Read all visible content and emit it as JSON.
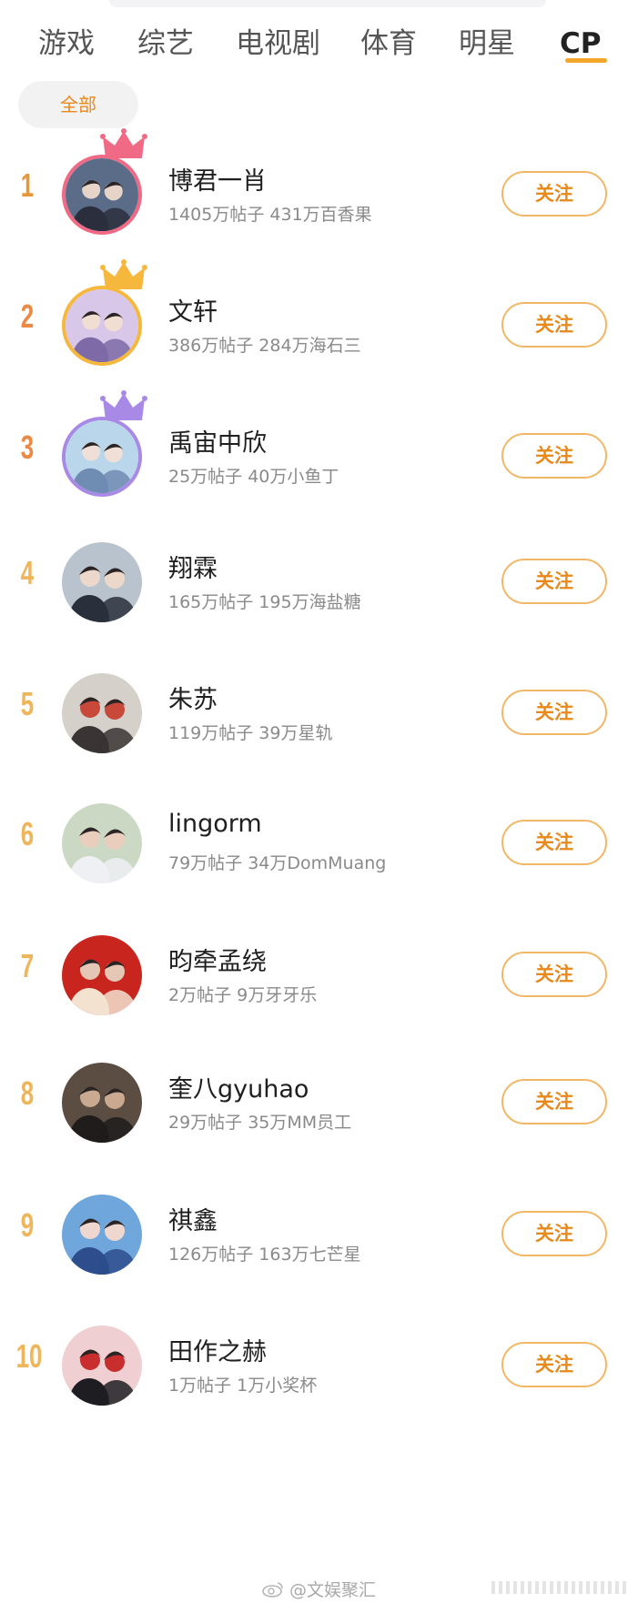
{
  "tabs": [
    {
      "label": "游戏",
      "active": false
    },
    {
      "label": "综艺",
      "active": false
    },
    {
      "label": "电视剧",
      "active": false
    },
    {
      "label": "体育",
      "active": false
    },
    {
      "label": "明星",
      "active": false
    },
    {
      "label": "CP",
      "active": true
    }
  ],
  "filter": {
    "label": "全部"
  },
  "follow_label": "关注",
  "colors": {
    "accent": "#e8891b",
    "rank_gold": "#e5973a",
    "rank_orange": "#ea8a44",
    "rank_light": "#eeb55a",
    "crown_red": "#f06a86",
    "crown_gold": "#f5b73c",
    "crown_purple": "#a88ae6"
  },
  "list": [
    {
      "rank": "1",
      "name": "博君一肖",
      "stats": "1405万帖子 431万百香果",
      "crown": "crown-red-icon",
      "avatar": "cp-photo-avatar"
    },
    {
      "rank": "2",
      "name": "文轩",
      "stats": "386万帖子 284万海石三",
      "crown": "crown-gold-icon",
      "avatar": "cp-photo-avatar"
    },
    {
      "rank": "3",
      "name": "禹宙中欣",
      "stats": "25万帖子 40万小鱼丁",
      "crown": "crown-purple-icon",
      "avatar": "cp-photo-avatar"
    },
    {
      "rank": "4",
      "name": "翔霖",
      "stats": "165万帖子 195万海盐糖",
      "avatar": "cp-photo-avatar"
    },
    {
      "rank": "5",
      "name": "朱苏",
      "stats": "119万帖子 39万星轨",
      "avatar": "cp-photo-avatar"
    },
    {
      "rank": "6",
      "name": "lingorm",
      "stats": "79万帖子 34万DomMuang",
      "avatar": "cp-photo-avatar"
    },
    {
      "rank": "7",
      "name": "昀牵孟绕",
      "stats": "2万帖子 9万牙牙乐",
      "avatar": "cp-photo-avatar"
    },
    {
      "rank": "8",
      "name": "奎八gyuhao",
      "stats": "29万帖子 35万MM员工",
      "avatar": "cp-photo-avatar"
    },
    {
      "rank": "9",
      "name": "祺鑫",
      "stats": "126万帖子 163万七芒星",
      "avatar": "cp-photo-avatar"
    },
    {
      "rank": "10",
      "name": "田作之赫",
      "stats": "1万帖子 1万小奖杯",
      "avatar": "cp-photo-avatar"
    }
  ],
  "watermark": "@文娱聚汇"
}
